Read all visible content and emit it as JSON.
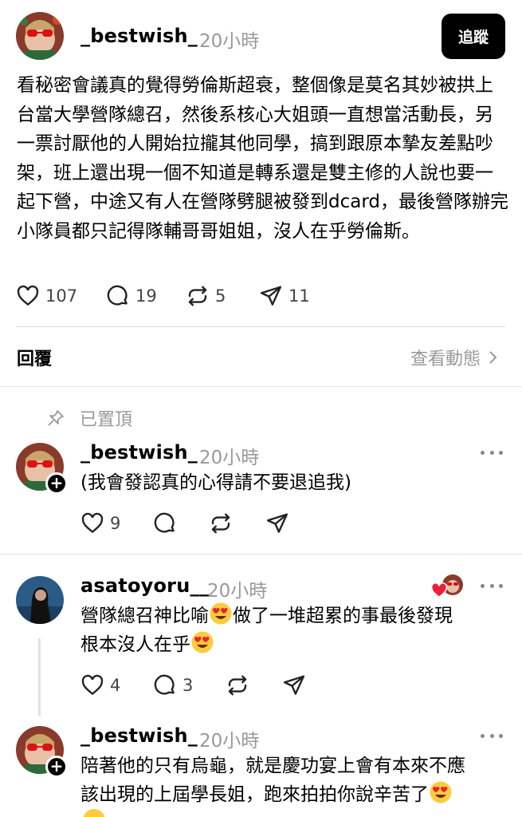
{
  "post": {
    "username": "_bestwish_",
    "time": "20小時",
    "follow_label": "追蹤",
    "body": "看秘密會議真的覺得勞倫斯超衰，整個像是莫名其妙被拱上台當大學營隊總召，然後系核心大姐頭一直想當活動長，另一票討厭他的人開始拉攏其他同學，搞到跟原本摯友差點吵架，班上還出現一個不知道是轉系還是雙主修的人說也要一起下營，中途又有人在營隊劈腿被發到dcard，最後營隊辦完小隊員都只記得隊輔哥哥姐姐，沒人在乎勞倫斯。",
    "likes": "107",
    "comments": "19",
    "reposts": "5",
    "shares": "11"
  },
  "replies_header": {
    "label": "回覆",
    "view_activity": "查看動態"
  },
  "pinned_label": "已置頂",
  "comments": [
    {
      "username": "_bestwish_",
      "time": "20小時",
      "text": "(我會發認真的心得請不要退追我)",
      "likes": "9"
    },
    {
      "username": "asatoyoru__",
      "time": "20小時",
      "text_a": "營隊總召神比喻",
      "text_b": "做了一堆超累的事最後發現",
      "text_c": "根本沒人在乎",
      "emoji": "heart-eyes",
      "likes": "4",
      "comments": "3"
    },
    {
      "username": "_bestwish_",
      "time": "20小時",
      "text_a": "陪著他的只有烏龜，就是慶功宴上會有本來不應",
      "text_b": "該出現的上屆學長姐，跑來拍拍你說辛苦了",
      "emoji": "heart-eyes"
    }
  ],
  "colors": {
    "like_heart": "#ee1d3a",
    "muted": "#999999",
    "divider": "#e2e2e2"
  }
}
